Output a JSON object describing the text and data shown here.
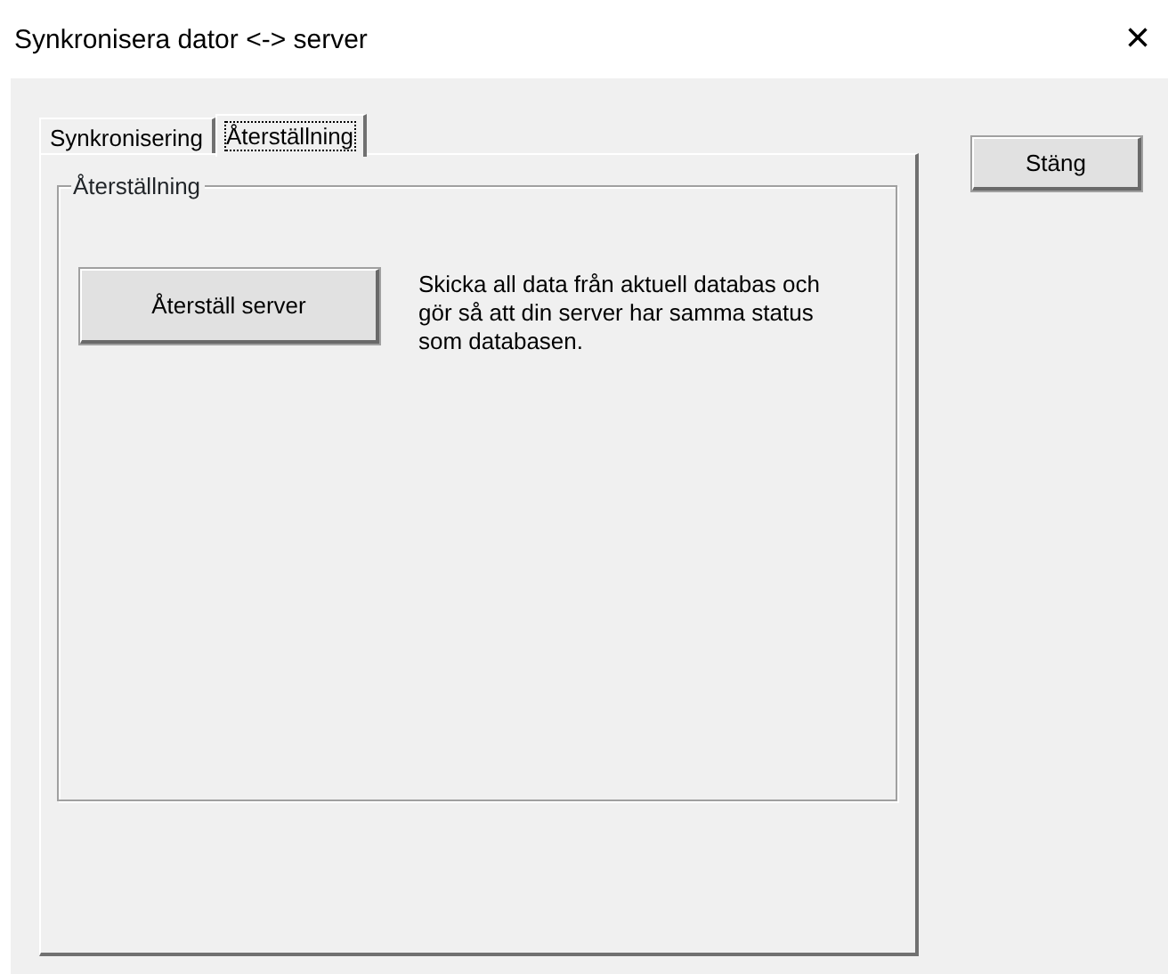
{
  "window": {
    "title": "Synkronisera dator <-> server",
    "close": "×"
  },
  "tabs": [
    {
      "label": "Synkronisering",
      "selected": false
    },
    {
      "label": "Återställning",
      "selected": true
    }
  ],
  "group": {
    "legend": "Återställning",
    "button": {
      "label": "Återställ server"
    },
    "description": "Skicka all data från aktuell databas och gör så att din server har samma status som databasen."
  },
  "buttons": [
    {
      "label": "Stäng"
    }
  ]
}
